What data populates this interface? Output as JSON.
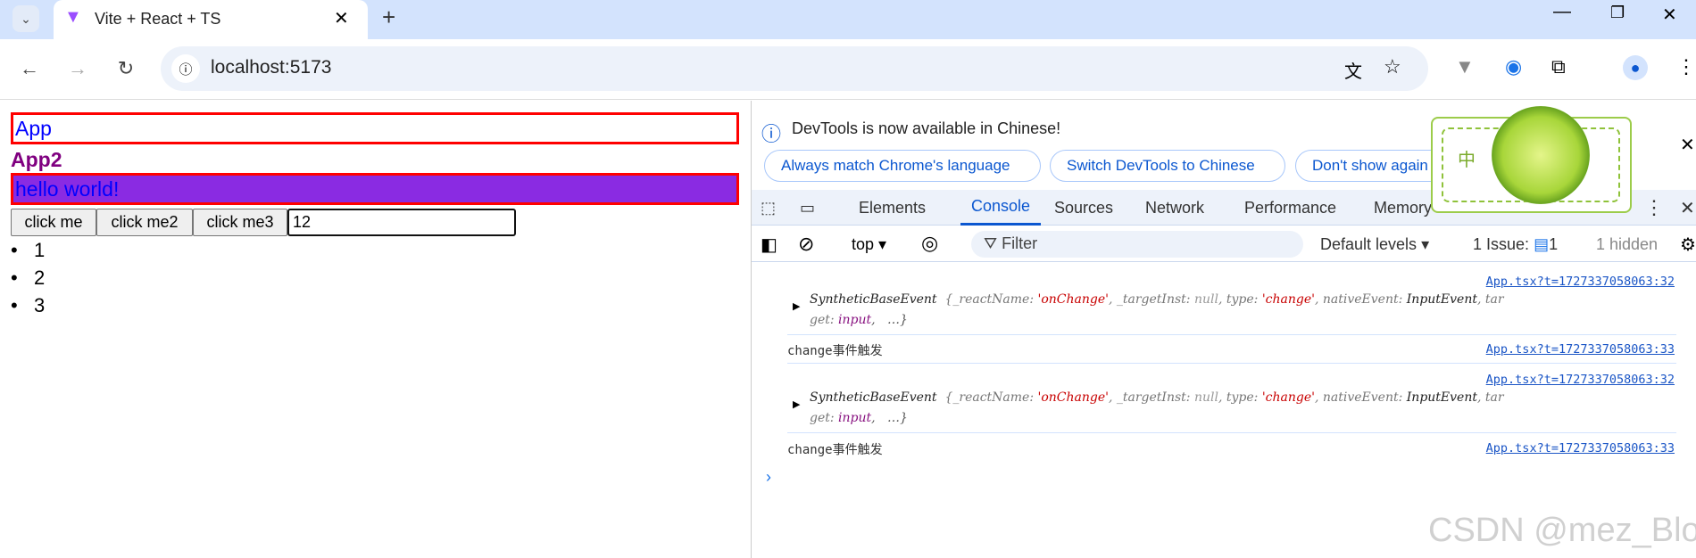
{
  "browser": {
    "tab_title": "Vite + React + TS",
    "url": "localhost:5173"
  },
  "page": {
    "app": "App",
    "app2": "App2",
    "hello": "hello world!",
    "buttons": [
      "click me",
      "click me2",
      "click me3"
    ],
    "input_value": "12",
    "list": [
      "1",
      "2",
      "3"
    ]
  },
  "devtools": {
    "infobar": {
      "message": "DevTools is now available in Chinese!",
      "buttons": [
        "Always match Chrome's language",
        "Switch DevTools to Chinese",
        "Don't show again"
      ]
    },
    "tabs": [
      "Elements",
      "Console",
      "Sources",
      "Network",
      "Performance",
      "Memory"
    ],
    "active_tab": "Console",
    "toolbar": {
      "context": "top",
      "filter_placeholder": "Filter",
      "levels": "Default levels",
      "issues_label": "1 Issue:",
      "issues_count": "1",
      "hidden": "1 hidden"
    },
    "logs": [
      {
        "type": "object",
        "source": "App.tsx?t=1727337058063:32",
        "line1": [
          "SyntheticBaseEvent",
          "{_reactName:",
          "'onChange'",
          ", _targetInst:",
          "null",
          ", type:",
          "'change'",
          ", nativeEvent:",
          "InputEvent",
          ", tar"
        ],
        "line2": [
          "get:",
          "input",
          ",",
          "…}"
        ]
      },
      {
        "type": "text",
        "source": "App.tsx?t=1727337058063:33",
        "text": "change事件触发"
      },
      {
        "type": "object",
        "source": "App.tsx?t=1727337058063:32",
        "line1": [
          "SyntheticBaseEvent",
          "{_reactName:",
          "'onChange'",
          ", _targetInst:",
          "null",
          ", type:",
          "'change'",
          ", nativeEvent:",
          "InputEvent",
          ", tar"
        ],
        "line2": [
          "get:",
          "input",
          ",",
          "…}"
        ]
      },
      {
        "type": "text",
        "source": "App.tsx?t=1727337058063:33",
        "text": "change事件触发"
      }
    ],
    "widget_char": "中"
  },
  "watermark": "CSDN @mez_Blog",
  "colors": {
    "accent": "#0b57d0",
    "red_border": "#ff0000",
    "hello_bg": "#8a2be2",
    "app2": "#800080"
  }
}
